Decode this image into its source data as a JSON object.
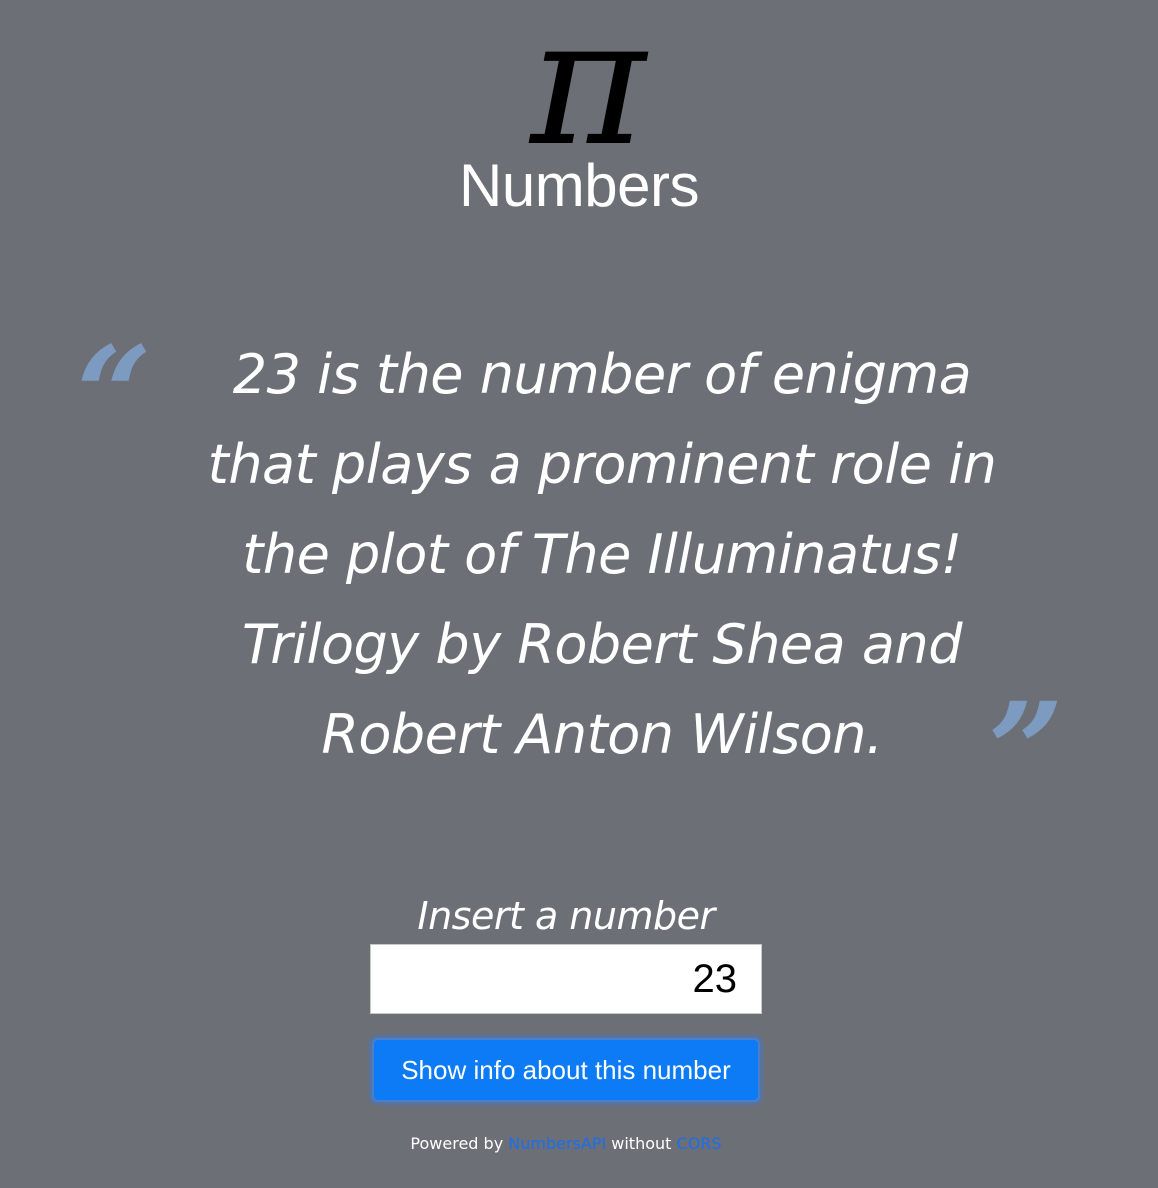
{
  "app": {
    "logo_glyph": "π",
    "title": "Numbers"
  },
  "quote": {
    "open_mark": "“",
    "text": "23 is the number of enigma that plays a prominent role in the plot of The Illuminatus! Trilogy by Robert Shea and Robert Anton Wilson.",
    "close_mark": "”"
  },
  "form": {
    "label": "Insert a number",
    "input_value": "23",
    "button_label": "Show info about this number"
  },
  "footer": {
    "prefix": "Powered by",
    "api_link": "NumbersAPI",
    "middle": "without",
    "cors_link": "CORS"
  },
  "colors": {
    "background": "#6c6f75",
    "quote_marks": "#7d9ac1",
    "button": "#0d7bf5",
    "link": "#1a6ef0"
  }
}
